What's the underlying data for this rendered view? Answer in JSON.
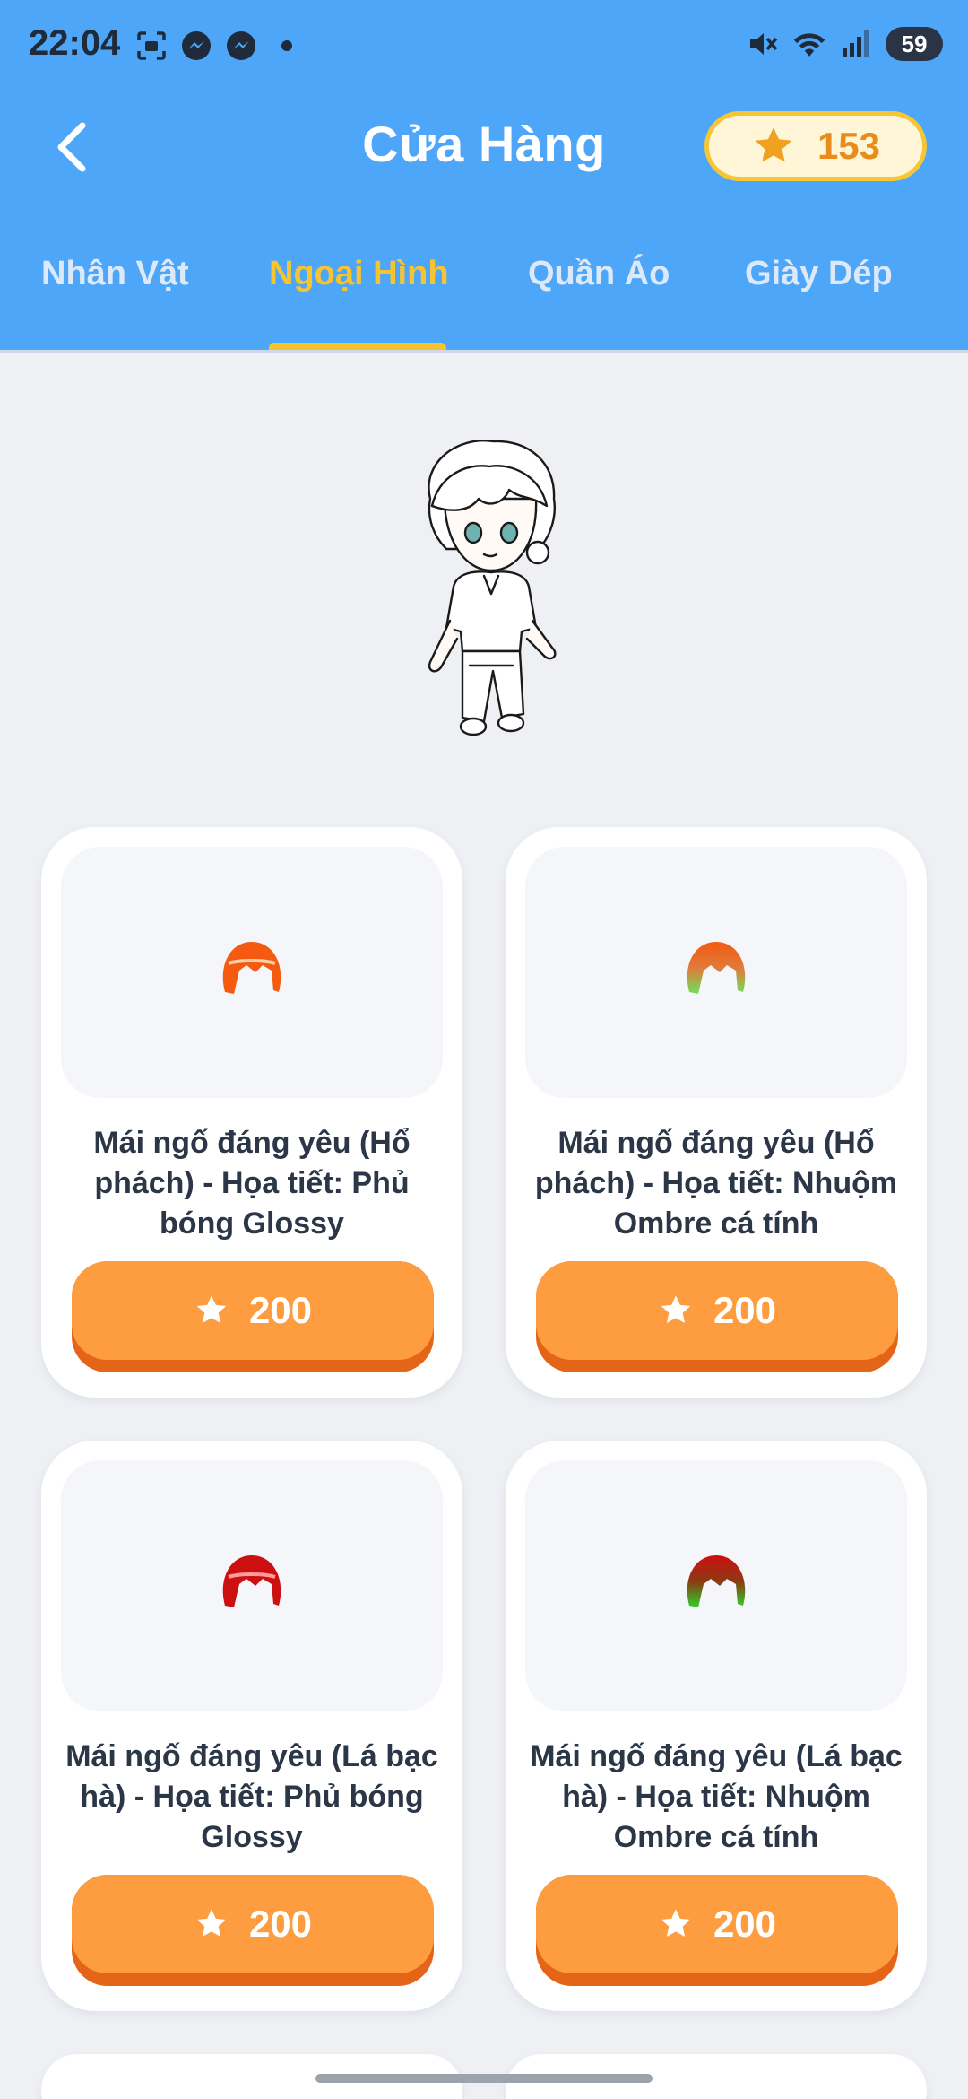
{
  "status_bar": {
    "time": "22:04",
    "battery": "59"
  },
  "header": {
    "title": "Cửa Hàng",
    "coins": "153"
  },
  "tabs": [
    {
      "label": "Nhân Vật",
      "active": false
    },
    {
      "label": "Ngoại Hình",
      "active": true
    },
    {
      "label": "Quần Áo",
      "active": false
    },
    {
      "label": "Giày Dép",
      "active": false
    }
  ],
  "colors": {
    "header": "#4ea6f8",
    "active_tab": "#f6c431",
    "buy_button": "#fd9d40",
    "coin_text": "#e98c1c"
  },
  "items": [
    {
      "name": "Mái ngố đáng yêu (Hổ phách) - Họa tiết: Phủ bóng Glossy",
      "price": "200",
      "icon": "orange-hair-glossy-icon"
    },
    {
      "name": "Mái ngố đáng yêu (Hổ phách) - Họa tiết: Nhuộm Ombre cá tính",
      "price": "200",
      "icon": "orange-green-ombre-hair-icon"
    },
    {
      "name": "Mái ngố đáng yêu (Lá bạc hà) - Họa tiết: Phủ bóng Glossy",
      "price": "200",
      "icon": "red-hair-glossy-icon"
    },
    {
      "name": "Mái ngố đáng yêu (Lá bạc hà) - Họa tiết: Nhuộm Ombre cá tính",
      "price": "200",
      "icon": "red-green-ombre-hair-icon"
    }
  ]
}
